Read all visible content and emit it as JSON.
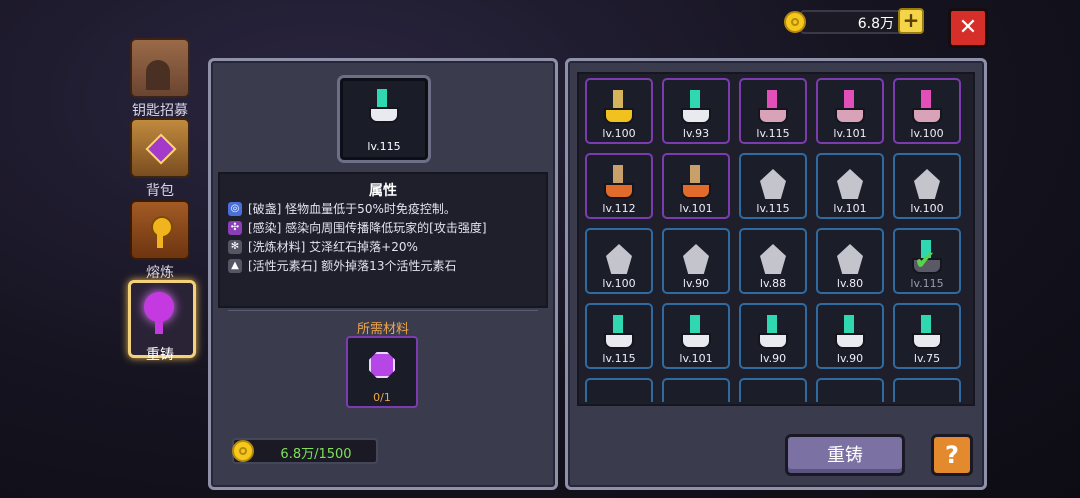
{
  "topbar": {
    "currency": "6.8万",
    "add_label": "+",
    "close_label": "✕"
  },
  "sidebar": {
    "items": [
      {
        "label": "钥匙招募",
        "icon": "gate-icon",
        "color": "#8a5a3c"
      },
      {
        "label": "背包",
        "icon": "backpack-chest-icon",
        "color": "#a0692f"
      },
      {
        "label": "熔炼",
        "icon": "smelt-chest-icon",
        "color": "#8c4f22"
      },
      {
        "label": "重铸",
        "icon": "purple-key-icon",
        "color": "#b233d0"
      }
    ]
  },
  "detail": {
    "selected_level": "lv.115",
    "section_title": "属性",
    "attributes": [
      {
        "text": "[破盏] 怪物血量低于50%时免疫控制。",
        "color": "#4a6fd8"
      },
      {
        "text": "[感染] 感染向周围传播降低玩家的[攻击强度]",
        "color": "#8a3fb8"
      },
      {
        "text": "[洗炼材料] 艾泽红石掉落+20%",
        "color": "#555566"
      },
      {
        "text": "[活性元素石] 额外掉落13个活性元素石",
        "color": "#555566"
      }
    ],
    "materials_title": "所需材料",
    "material_count": "0/1",
    "cost": "6.8万/1500"
  },
  "grid": {
    "items": [
      {
        "level": "lv.100",
        "type": "gold-key",
        "border": "#7b3cb0"
      },
      {
        "level": "lv.93",
        "type": "teal-key",
        "border": "#7b3cb0"
      },
      {
        "level": "lv.115",
        "type": "pink-key",
        "border": "#7b3cb0"
      },
      {
        "level": "lv.101",
        "type": "pink-key",
        "border": "#7b3cb0"
      },
      {
        "level": "lv.100",
        "type": "pink-key",
        "border": "#7b3cb0"
      },
      {
        "level": "lv.112",
        "type": "orange-key",
        "border": "#7b3cb0"
      },
      {
        "level": "lv.101",
        "type": "orange-key",
        "border": "#7b3cb0"
      },
      {
        "level": "lv.115",
        "type": "grey-shard",
        "border": "#2f6aa0"
      },
      {
        "level": "lv.101",
        "type": "grey-shard",
        "border": "#2f6aa0"
      },
      {
        "level": "lv.100",
        "type": "grey-shard",
        "border": "#2f6aa0"
      },
      {
        "level": "lv.100",
        "type": "grey-shard",
        "border": "#2f6aa0"
      },
      {
        "level": "lv.90",
        "type": "grey-shard",
        "border": "#2f6aa0"
      },
      {
        "level": "lv.88",
        "type": "grey-shard",
        "border": "#2f6aa0"
      },
      {
        "level": "lv.80",
        "type": "grey-shard",
        "border": "#2f6aa0"
      },
      {
        "level": "lv.115",
        "type": "selected-teal-key",
        "border": "#2f6aa0"
      },
      {
        "level": "lv.115",
        "type": "teal-key",
        "border": "#2f6aa0"
      },
      {
        "level": "lv.101",
        "type": "teal-key",
        "border": "#2f6aa0"
      },
      {
        "level": "lv.90",
        "type": "teal-key",
        "border": "#2f6aa0"
      },
      {
        "level": "lv.90",
        "type": "teal-key",
        "border": "#2f6aa0"
      },
      {
        "level": "lv.75",
        "type": "teal-key",
        "border": "#2f6aa0"
      }
    ]
  },
  "actions": {
    "reforge_label": "重铸",
    "help_label": "?"
  }
}
